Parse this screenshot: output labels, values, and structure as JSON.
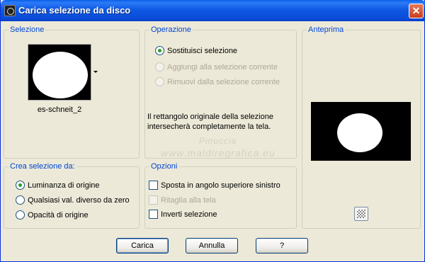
{
  "window": {
    "title": "Carica selezione da disco",
    "close_label": "✕"
  },
  "selezione": {
    "legend": "Selezione",
    "file_name": "es-schneit_2"
  },
  "operazione": {
    "legend": "Operazione",
    "options": [
      {
        "label": "Sostituisci selezione",
        "checked": true,
        "enabled": true
      },
      {
        "label": "Aggiungi alla selezione corrente",
        "checked": false,
        "enabled": false
      },
      {
        "label": "Rimuovi dalla selezione corrente",
        "checked": false,
        "enabled": false
      }
    ],
    "info_line1": "Il rettangolo originale della selezione",
    "info_line2": "intersecherà completamente la tela."
  },
  "anteprima": {
    "legend": "Anteprima",
    "zoom_icon": "checker-icon"
  },
  "crea": {
    "legend": "Crea selezione da:",
    "options": [
      {
        "label": "Luminanza di origine",
        "checked": true
      },
      {
        "label": "Qualsiasi val. diverso da zero",
        "checked": false
      },
      {
        "label": "Opacità di origine",
        "checked": false
      }
    ]
  },
  "opzioni": {
    "legend": "Opzioni",
    "options": [
      {
        "label": "Sposta in angolo superiore sinistro",
        "checked": false,
        "enabled": true
      },
      {
        "label": "Ritaglia alla tela",
        "checked": false,
        "enabled": false
      },
      {
        "label": "Inverti selezione",
        "checked": false,
        "enabled": true
      }
    ]
  },
  "watermark": {
    "line1": "Pinuccia",
    "line2": "www.maldiregrafica.eu"
  },
  "buttons": {
    "ok": "Carica",
    "cancel": "Annulla",
    "help": "?"
  },
  "colors": {
    "titlebar": "#0A5FE8",
    "legend": "#0046D5",
    "dialog_bg": "#ECE9D8",
    "radio_dot": "#21A121"
  }
}
